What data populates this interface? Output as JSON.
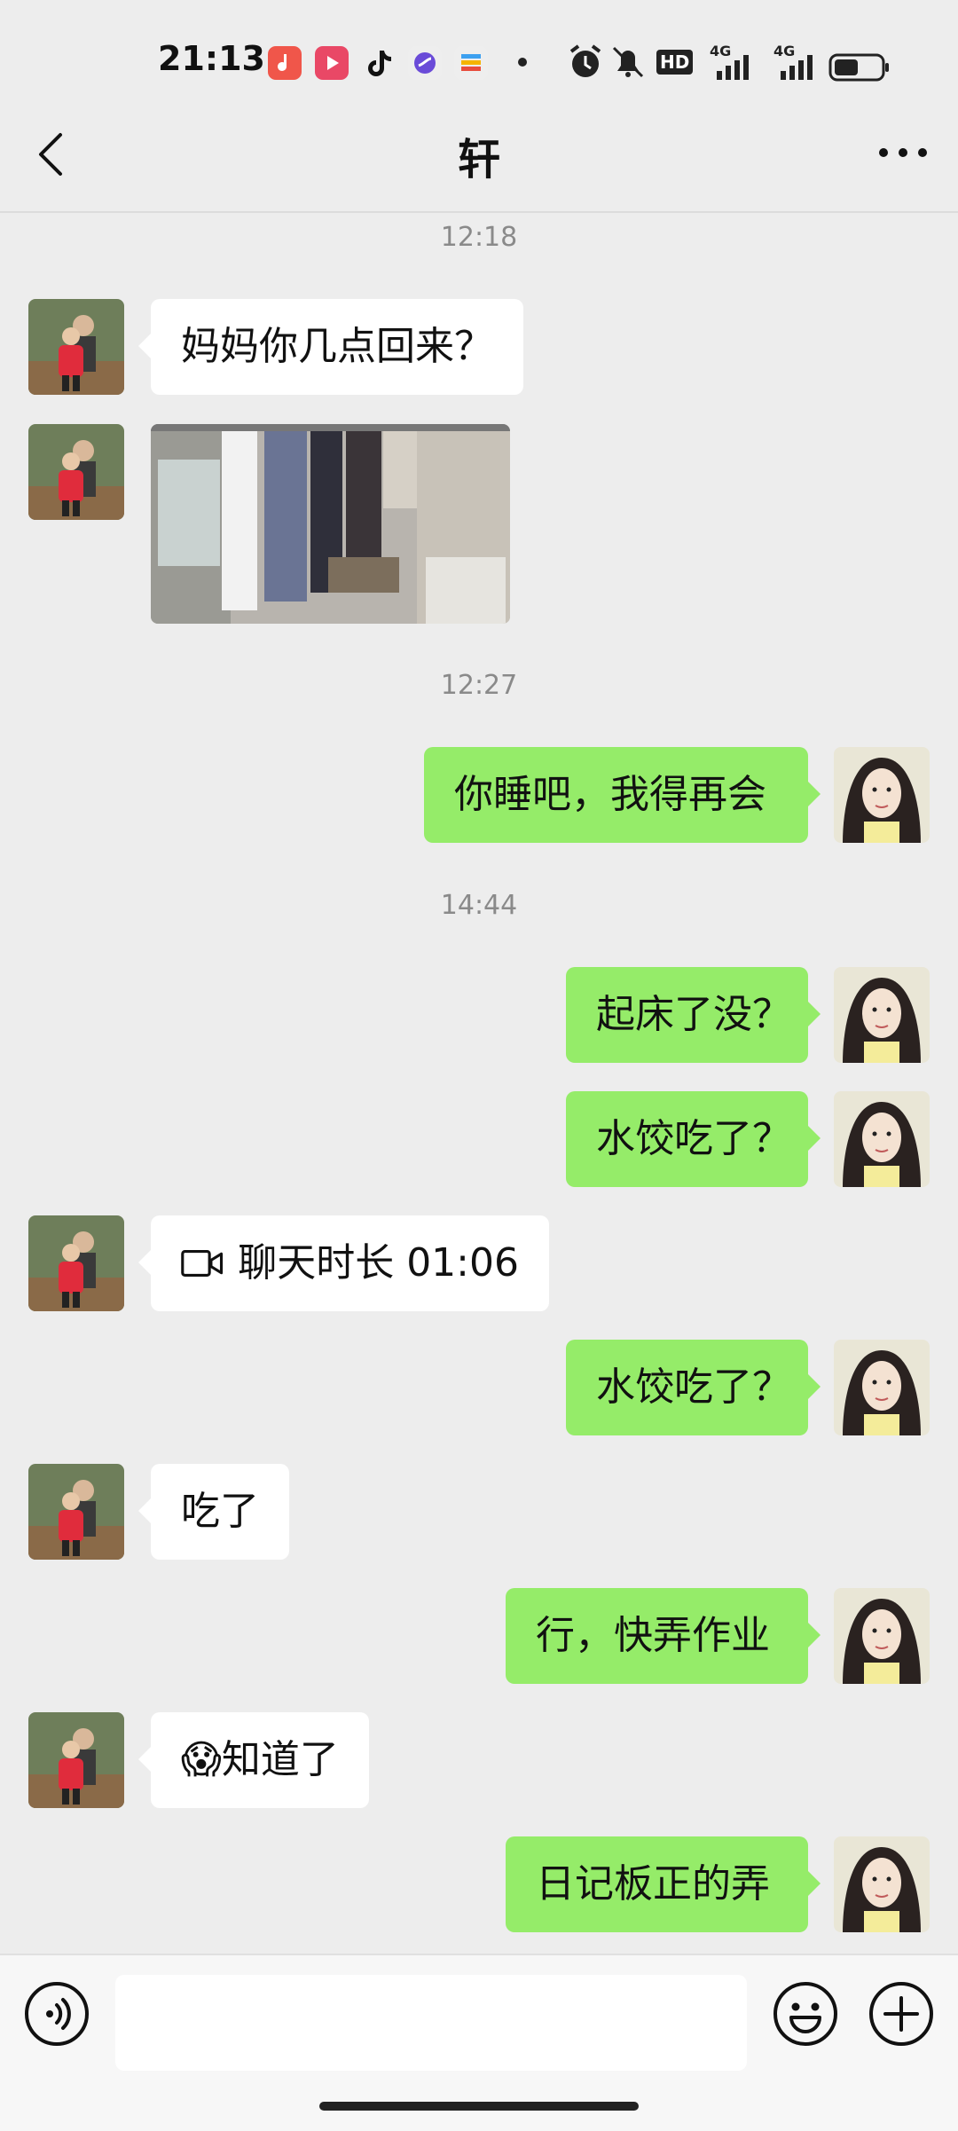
{
  "status_bar": {
    "time": "21:13",
    "app_icons": [
      "music-icon",
      "video-icon",
      "tiktok-icon",
      "app-icon",
      "wallet-icon"
    ],
    "right_icons": [
      "alarm-icon",
      "mute-icon",
      "hd-icon",
      "signal-4g-icon",
      "signal-4g-icon",
      "battery-icon"
    ],
    "hd_label": "HD",
    "net_label": "4G"
  },
  "header": {
    "title": "轩"
  },
  "messages": {
    "ts1": "12:18",
    "m1": "妈妈你几点回来？",
    "ts2": "12:27",
    "m2": "你睡吧，我得再会",
    "ts3": "14:44",
    "m3": "起床了没？",
    "m4": "水饺吃了？",
    "m5": "聊天时长 01:06",
    "m6": "水饺吃了？",
    "m7": "吃了",
    "m8": "行，快弄作业",
    "m9": "😱知道了",
    "m10": "日记板正的弄"
  },
  "input": {
    "value": "",
    "placeholder": ""
  },
  "colors": {
    "outgoing_bubble": "#95EC69",
    "incoming_bubble": "#FFFFFF",
    "background": "#EDEDED"
  }
}
